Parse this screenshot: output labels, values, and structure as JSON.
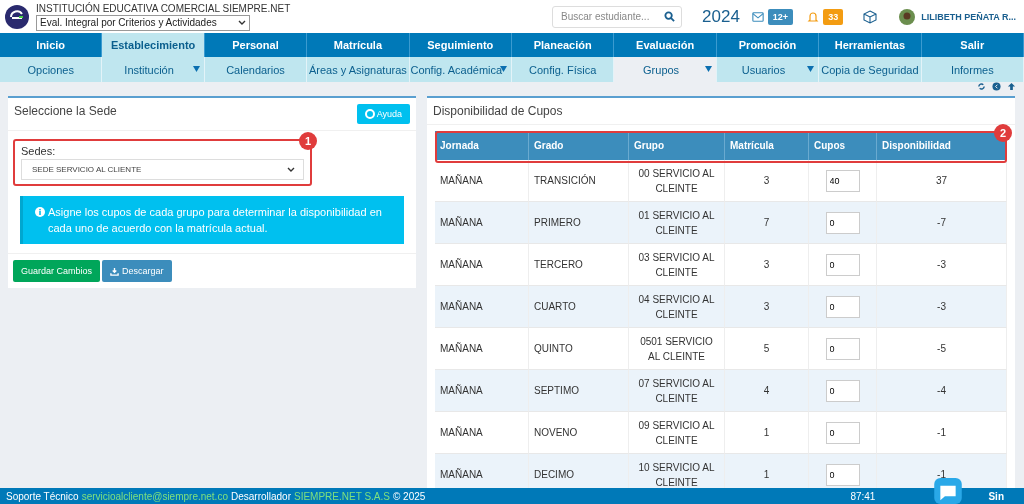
{
  "header": {
    "institution": "INSTITUCIÓN EDUCATIVA COMERCIAL SIEMPRE.NET",
    "mode_select": "Eval. Integral por Criterios y Actividades",
    "search": {
      "placeholder": "Buscar estudiante..."
    },
    "year": "2024",
    "messages_badge": "12+",
    "alerts_badge": "33",
    "user": "LILIBETH PEÑATA R..."
  },
  "menu": [
    {
      "label": "Inicio",
      "selected": false
    },
    {
      "label": "Establecimiento",
      "selected": true
    },
    {
      "label": "Personal",
      "selected": false
    },
    {
      "label": "Matrícula",
      "selected": false
    },
    {
      "label": "Seguimiento",
      "selected": false
    },
    {
      "label": "Planeación",
      "selected": false
    },
    {
      "label": "Evaluación",
      "selected": false
    },
    {
      "label": "Promoción",
      "selected": false
    },
    {
      "label": "Herramientas",
      "selected": false
    },
    {
      "label": "Salir",
      "selected": false
    }
  ],
  "submenu": [
    {
      "label": "Opciones",
      "selected": false,
      "dropdown": false
    },
    {
      "label": "Institución",
      "selected": false,
      "dropdown": true
    },
    {
      "label": "Calendarios",
      "selected": false,
      "dropdown": false
    },
    {
      "label": "Áreas y Asignaturas",
      "selected": false,
      "dropdown": false
    },
    {
      "label": "Config. Académica",
      "selected": false,
      "dropdown": true
    },
    {
      "label": "Config. Física",
      "selected": false,
      "dropdown": false
    },
    {
      "label": "Grupos",
      "selected": true,
      "dropdown": true
    },
    {
      "label": "Usuarios",
      "selected": false,
      "dropdown": true
    },
    {
      "label": "Copia de Seguridad",
      "selected": false,
      "dropdown": false
    },
    {
      "label": "Informes",
      "selected": false,
      "dropdown": false
    }
  ],
  "left_panel": {
    "title": "Seleccione la Sede",
    "help_button": "Ayuda",
    "callout": "1",
    "field_label": "Sedes:",
    "sede": "SEDE SERVICIO AL CLIENTE",
    "info": "Asigne los cupos de cada grupo para determinar la disponibilidad en cada uno de acuerdo con la matrícula actual.",
    "buttons": [
      "Guardar Cambios",
      "Descargar"
    ]
  },
  "right_panel": {
    "title": "Disponibilidad de Cupos",
    "callout": "2",
    "table": {
      "columns": [
        "Jornada",
        "Grado",
        "Grupo",
        "Matrícula",
        "Cupos",
        "Disponibilidad"
      ],
      "rows": [
        {
          "jornada": "MAÑANA",
          "grado": "TRANSICIÓN",
          "grupo": "00 SERVICIO AL CLEINTE",
          "matricula": "3",
          "cupos": "40",
          "disponibilidad": "37"
        },
        {
          "jornada": "MAÑANA",
          "grado": "PRIMERO",
          "grupo": "01 SERVICIO AL CLEINTE",
          "matricula": "7",
          "cupos": "0",
          "disponibilidad": "-7"
        },
        {
          "jornada": "MAÑANA",
          "grado": "TERCERO",
          "grupo": "03 SERVICIO AL CLEINTE",
          "matricula": "3",
          "cupos": "0",
          "disponibilidad": "-3"
        },
        {
          "jornada": "MAÑANA",
          "grado": "CUARTO",
          "grupo": "04 SERVICIO AL CLEINTE",
          "matricula": "3",
          "cupos": "0",
          "disponibilidad": "-3"
        },
        {
          "jornada": "MAÑANA",
          "grado": "QUINTO",
          "grupo": "0501 SERVICIO AL CLEINTE",
          "matricula": "5",
          "cupos": "0",
          "disponibilidad": "-5"
        },
        {
          "jornada": "MAÑANA",
          "grado": "SEPTIMO",
          "grupo": "07 SERVICIO AL CLEINTE",
          "matricula": "4",
          "cupos": "0",
          "disponibilidad": "-4"
        },
        {
          "jornada": "MAÑANA",
          "grado": "NOVENO",
          "grupo": "09 SERVICIO AL CLEINTE",
          "matricula": "1",
          "cupos": "0",
          "disponibilidad": "-1"
        },
        {
          "jornada": "MAÑANA",
          "grado": "DECIMO",
          "grupo": "10 SERVICIO AL CLEINTE",
          "matricula": "1",
          "cupos": "0",
          "disponibilidad": "-1"
        }
      ]
    }
  },
  "footer": {
    "support_label": "Soporte Técnico",
    "support_email": "servicioalcliente@siempre.net.co",
    "developer_label": "Desarrollador",
    "developer": "SIEMPRE.NET S.A.S",
    "copyright": "© 2025",
    "timer": "87:41",
    "logo": "Sin"
  }
}
